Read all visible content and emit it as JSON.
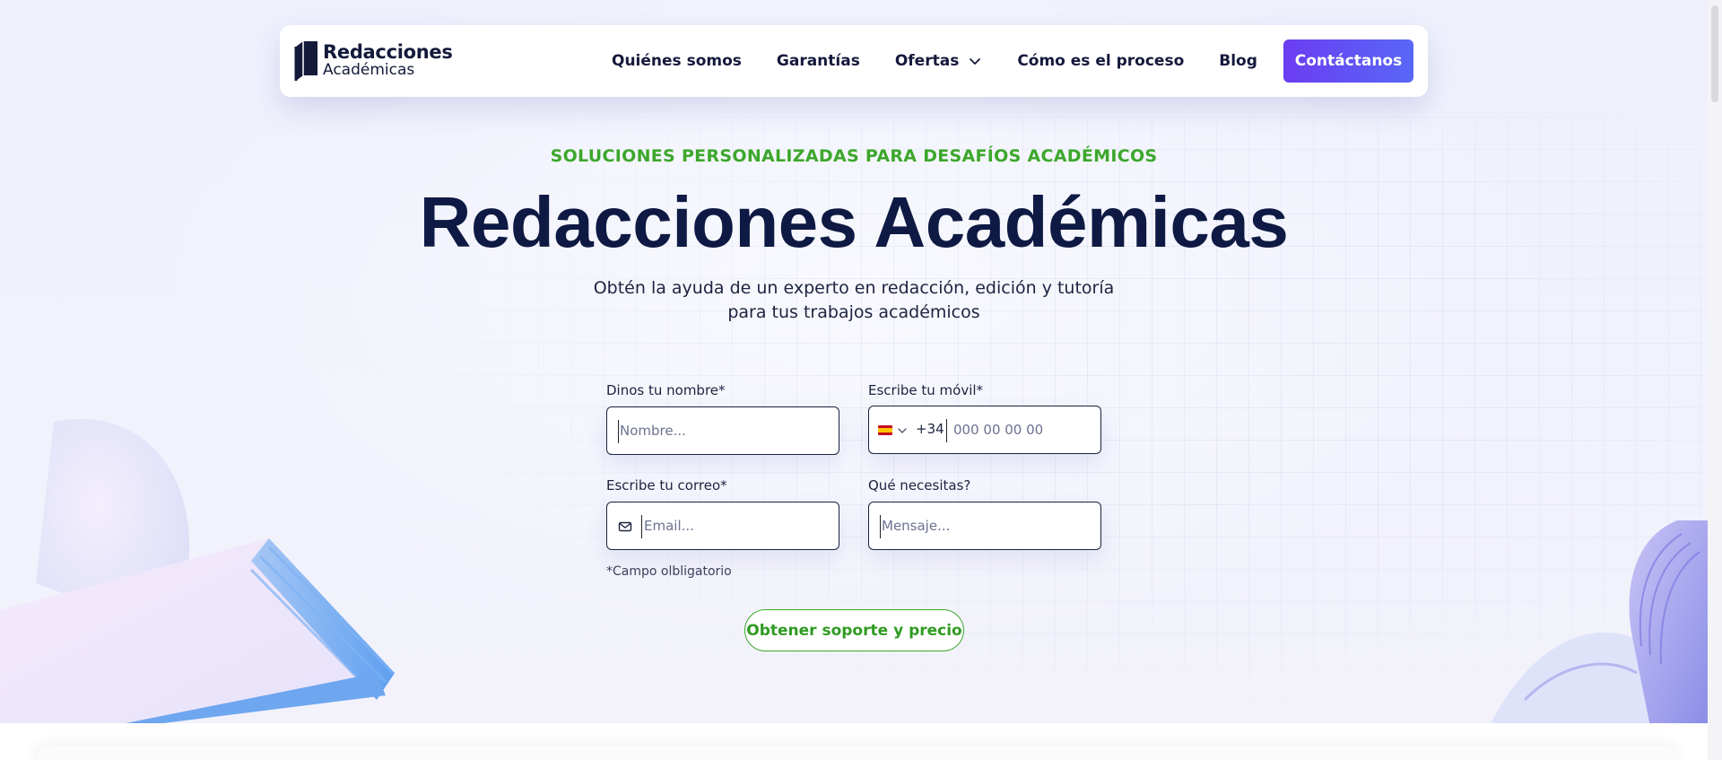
{
  "nav": {
    "logo_line1": "Redacciones",
    "logo_line2": "Académicas",
    "links": [
      "Quiénes somos",
      "Garantías",
      "Ofertas",
      "Cómo es el proceso",
      "Blog"
    ],
    "cta_label": "Contáctanos"
  },
  "hero": {
    "eyebrow": "SOLUCIONES PERSONALIZADAS PARA DESAFÍOS ACADÉMICOS",
    "title": "Redacciones Académicas",
    "subtitle": "Obtén la ayuda de un experto en redacción, edición y tutoría para tus trabajos académicos"
  },
  "form": {
    "name_label": "Dinos tu nombre*",
    "name_placeholder": "Nombre...",
    "phone_label": "Escribe tu móvil*",
    "phone_prefix": "+34",
    "phone_placeholder": "000 00 00 00",
    "email_label": "Escribe tu correo*",
    "email_placeholder": "Email...",
    "message_label": "Qué necesitas?",
    "message_placeholder": "Mensaje...",
    "required_note": "*Campo olbligatorio",
    "submit_label": "Obtener soporte y precio"
  },
  "colors": {
    "accent_green": "#3ca72b",
    "cta_purple": "#6b3df1",
    "title_navy": "#0e1a43"
  }
}
